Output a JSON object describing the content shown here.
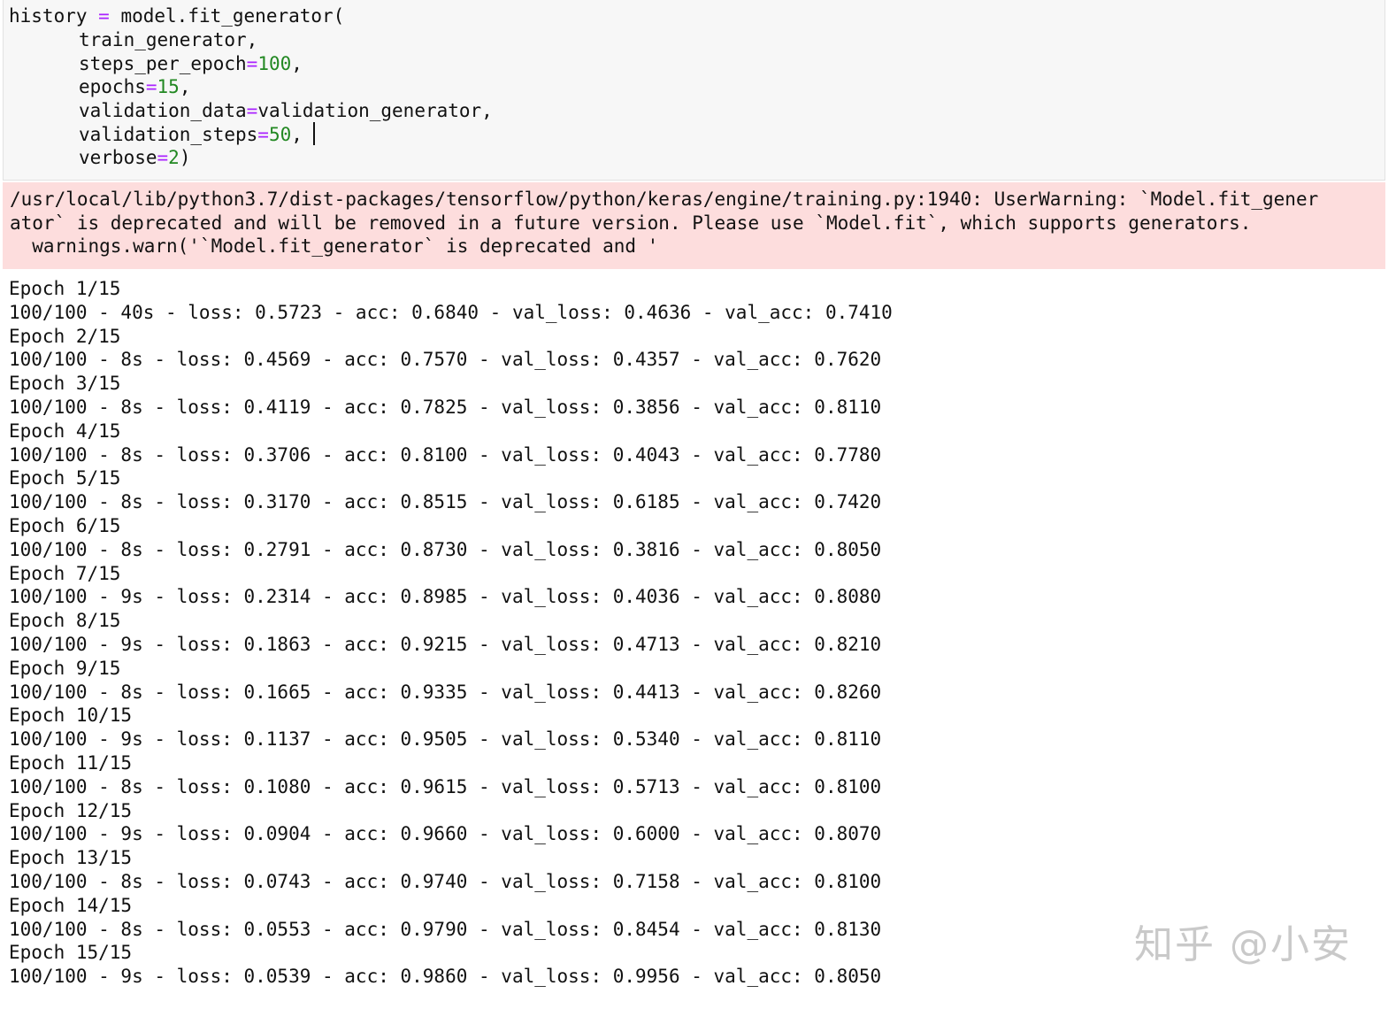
{
  "code": {
    "lines": [
      {
        "segments": [
          {
            "t": "history ",
            "c": "plain"
          },
          {
            "t": "=",
            "c": "op"
          },
          {
            "t": " model.fit_generator(",
            "c": "plain"
          }
        ]
      },
      {
        "segments": [
          {
            "t": "train_generator,",
            "c": "plain"
          }
        ]
      },
      {
        "segments": [
          {
            "t": "steps_per_epoch",
            "c": "plain"
          },
          {
            "t": "=",
            "c": "op"
          },
          {
            "t": "100",
            "c": "num"
          },
          {
            "t": ",",
            "c": "plain"
          }
        ]
      },
      {
        "segments": [
          {
            "t": "epochs",
            "c": "plain"
          },
          {
            "t": "=",
            "c": "op"
          },
          {
            "t": "15",
            "c": "num"
          },
          {
            "t": ",",
            "c": "plain"
          }
        ]
      },
      {
        "segments": [
          {
            "t": "validation_data",
            "c": "plain"
          },
          {
            "t": "=",
            "c": "op"
          },
          {
            "t": "validation_generator,",
            "c": "plain"
          }
        ]
      },
      {
        "segments": [
          {
            "t": "validation_steps",
            "c": "plain"
          },
          {
            "t": "=",
            "c": "op"
          },
          {
            "t": "50",
            "c": "num"
          },
          {
            "t": ",",
            "c": "plain"
          }
        ]
      },
      {
        "segments": [
          {
            "t": "verbose",
            "c": "plain"
          },
          {
            "t": "=",
            "c": "op"
          },
          {
            "t": "2",
            "c": "num"
          },
          {
            "t": ")",
            "c": "plain"
          }
        ]
      }
    ]
  },
  "stderr": {
    "lines": [
      "/usr/local/lib/python3.7/dist-packages/tensorflow/python/keras/engine/training.py:1940: UserWarning: `Model.fit_gener",
      "ator` is deprecated and will be removed in a future version. Please use `Model.fit`, which supports generators.",
      "  warnings.warn('`Model.fit_generator` is deprecated and '"
    ]
  },
  "output": {
    "lines": [
      "Epoch 1/15",
      "100/100 - 40s - loss: 0.5723 - acc: 0.6840 - val_loss: 0.4636 - val_acc: 0.7410",
      "Epoch 2/15",
      "100/100 - 8s - loss: 0.4569 - acc: 0.7570 - val_loss: 0.4357 - val_acc: 0.7620",
      "Epoch 3/15",
      "100/100 - 8s - loss: 0.4119 - acc: 0.7825 - val_loss: 0.3856 - val_acc: 0.8110",
      "Epoch 4/15",
      "100/100 - 8s - loss: 0.3706 - acc: 0.8100 - val_loss: 0.4043 - val_acc: 0.7780",
      "Epoch 5/15",
      "100/100 - 8s - loss: 0.3170 - acc: 0.8515 - val_loss: 0.6185 - val_acc: 0.7420",
      "Epoch 6/15",
      "100/100 - 8s - loss: 0.2791 - acc: 0.8730 - val_loss: 0.3816 - val_acc: 0.8050",
      "Epoch 7/15",
      "100/100 - 9s - loss: 0.2314 - acc: 0.8985 - val_loss: 0.4036 - val_acc: 0.8080",
      "Epoch 8/15",
      "100/100 - 9s - loss: 0.1863 - acc: 0.9215 - val_loss: 0.4713 - val_acc: 0.8210",
      "Epoch 9/15",
      "100/100 - 8s - loss: 0.1665 - acc: 0.9335 - val_loss: 0.4413 - val_acc: 0.8260",
      "Epoch 10/15",
      "100/100 - 9s - loss: 0.1137 - acc: 0.9505 - val_loss: 0.5340 - val_acc: 0.8110",
      "Epoch 11/15",
      "100/100 - 8s - loss: 0.1080 - acc: 0.9615 - val_loss: 0.5713 - val_acc: 0.8100",
      "Epoch 12/15",
      "100/100 - 9s - loss: 0.0904 - acc: 0.9660 - val_loss: 0.6000 - val_acc: 0.8070",
      "Epoch 13/15",
      "100/100 - 8s - loss: 0.0743 - acc: 0.9740 - val_loss: 0.7158 - val_acc: 0.8100",
      "Epoch 14/15",
      "100/100 - 8s - loss: 0.0553 - acc: 0.9790 - val_loss: 0.8454 - val_acc: 0.8130",
      "Epoch 15/15",
      "100/100 - 9s - loss: 0.0539 - acc: 0.9860 - val_loss: 0.9956 - val_acc: 0.8050"
    ]
  },
  "watermark": "知乎 @小安",
  "colors": {
    "operator": "#aa22ff",
    "number": "#228822",
    "code_bg": "#f7f7f7",
    "stderr_bg": "#fddddd"
  }
}
